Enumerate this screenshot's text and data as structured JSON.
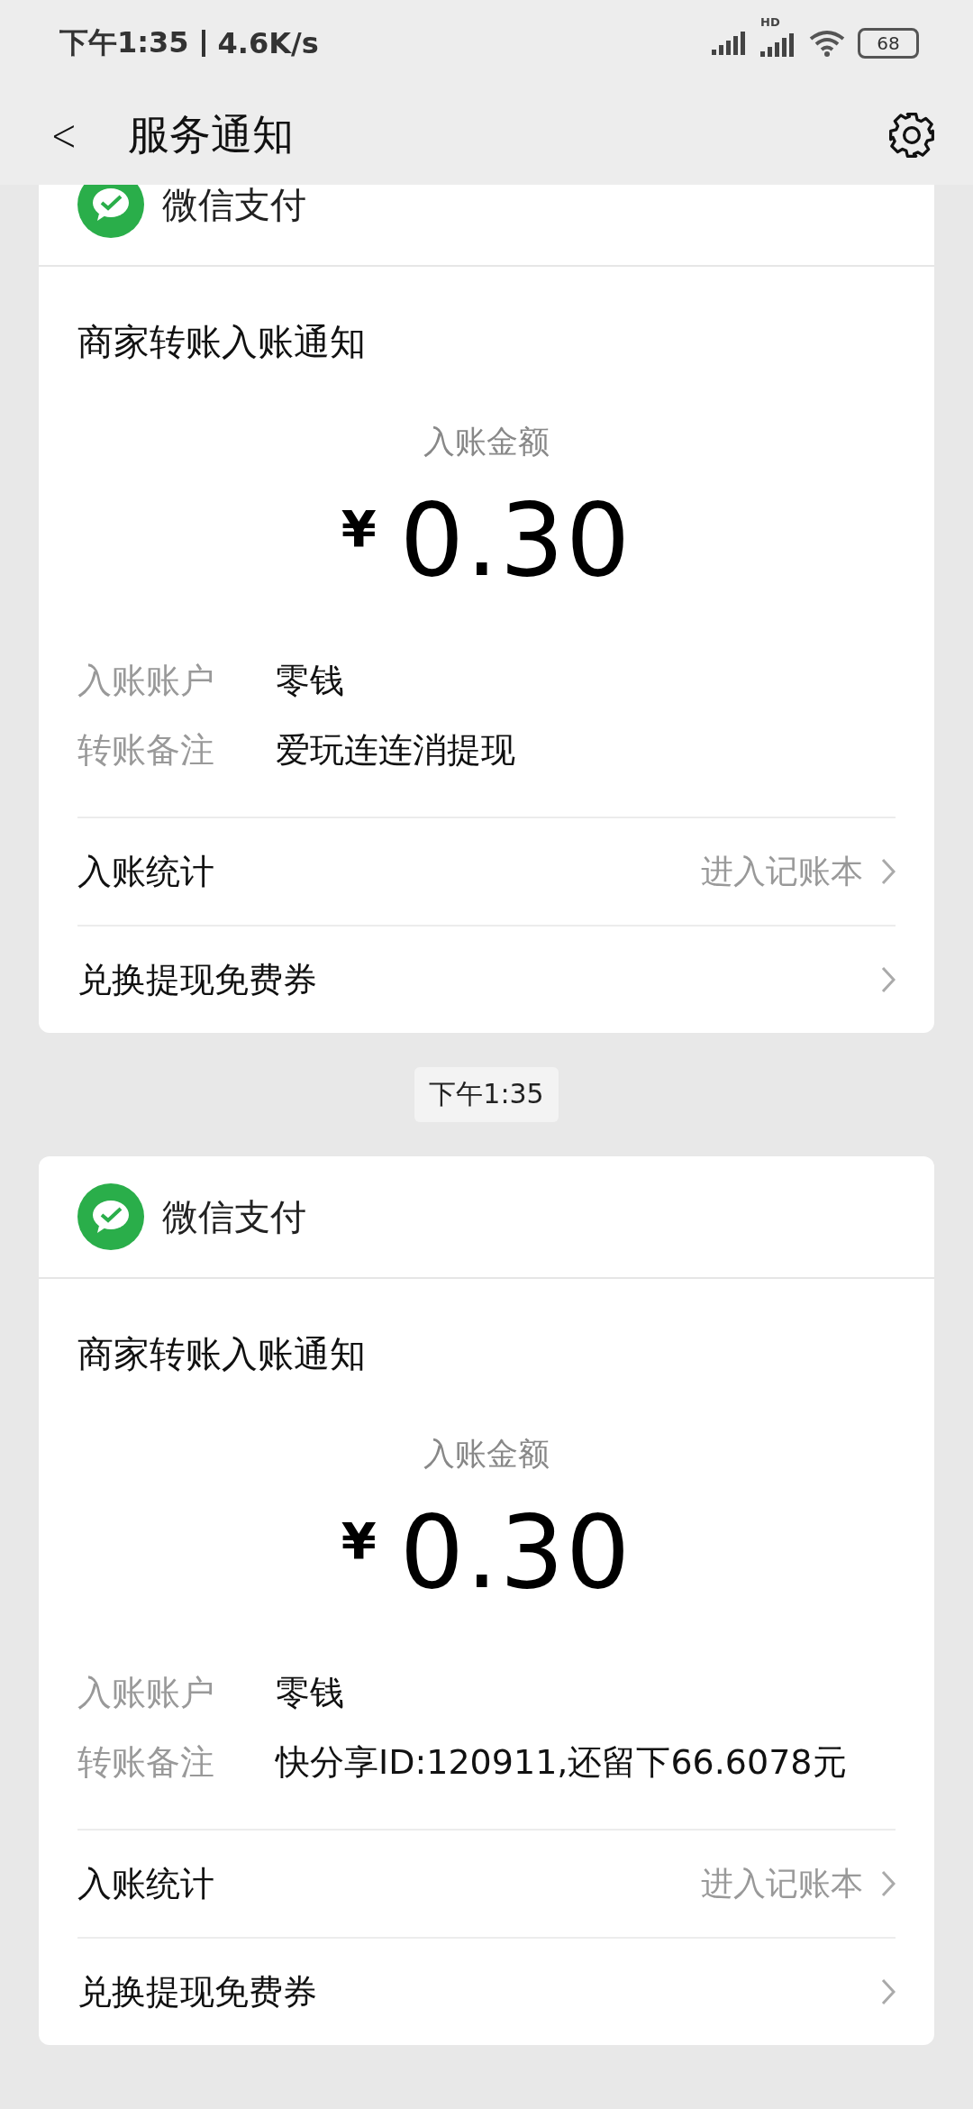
{
  "status_bar": {
    "time": "下午1:35",
    "speed": "4.6K/s",
    "battery": "68",
    "signal_label": "HD"
  },
  "header": {
    "back": "<",
    "title": "服务通知"
  },
  "messages": [
    {
      "sender": "微信支付",
      "title": "商家转账入账通知",
      "amount_label": "入账金额",
      "currency": "¥",
      "amount": "0.30",
      "fields": [
        {
          "label": "入账账户",
          "value": "零钱"
        },
        {
          "label": "转账备注",
          "value": "爱玩连连消提现"
        }
      ],
      "links": [
        {
          "label": "入账统计",
          "detail": "进入记账本"
        },
        {
          "label": "兑换提现免费券"
        }
      ]
    },
    {
      "timestamp": "下午1:35",
      "sender": "微信支付",
      "title": "商家转账入账通知",
      "amount_label": "入账金额",
      "currency": "¥",
      "amount": "0.30",
      "fields": [
        {
          "label": "入账账户",
          "value": "零钱"
        },
        {
          "label": "转账备注",
          "value": "快分享ID:120911,还留下66.6078元"
        }
      ],
      "links": [
        {
          "label": "入账统计",
          "detail": "进入记账本"
        },
        {
          "label": "兑换提现免费券"
        }
      ]
    }
  ]
}
